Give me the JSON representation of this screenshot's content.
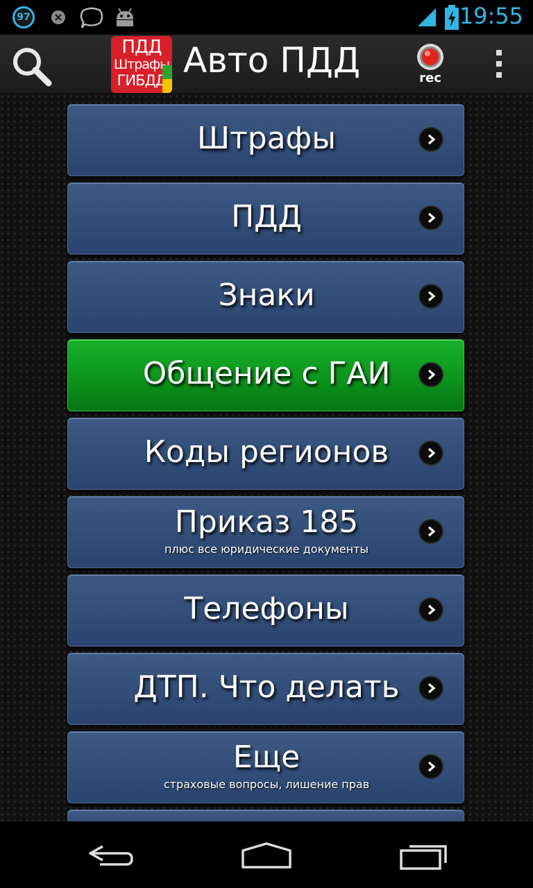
{
  "status_bar": {
    "notification_count": "97",
    "time": "19:55",
    "icons": [
      "notification-count-icon",
      "close-circle-icon",
      "chat-bubble-icon",
      "android-icon",
      "signal-icon",
      "battery-charging-icon"
    ]
  },
  "action_bar": {
    "title": "Авто ПДД",
    "logo_lines": [
      "ПДД",
      "Штрафы",
      "ГИБДД"
    ],
    "rec_label": "rec",
    "icons": [
      "search-icon",
      "record-icon",
      "overflow-menu-icon"
    ]
  },
  "menu": {
    "items": [
      {
        "label": "Штрафы",
        "sub": ""
      },
      {
        "label": "ПДД",
        "sub": ""
      },
      {
        "label": "Знаки",
        "sub": ""
      },
      {
        "label": "Общение с ГАИ",
        "sub": "",
        "active": true
      },
      {
        "label": "Коды регионов",
        "sub": ""
      },
      {
        "label": "Приказ 185",
        "sub": "плюс все юридические документы"
      },
      {
        "label": "Телефоны",
        "sub": ""
      },
      {
        "label": "ДТП. Что делать",
        "sub": ""
      },
      {
        "label": "Еще",
        "sub": "страховые вопросы, лишение прав"
      }
    ]
  },
  "nav_bar": {
    "icons": [
      "back-icon",
      "home-icon",
      "recent-apps-icon"
    ]
  },
  "colors": {
    "item_blue": "#34507a",
    "item_active_green": "#0d981d",
    "status_accent": "#33b5e5"
  }
}
